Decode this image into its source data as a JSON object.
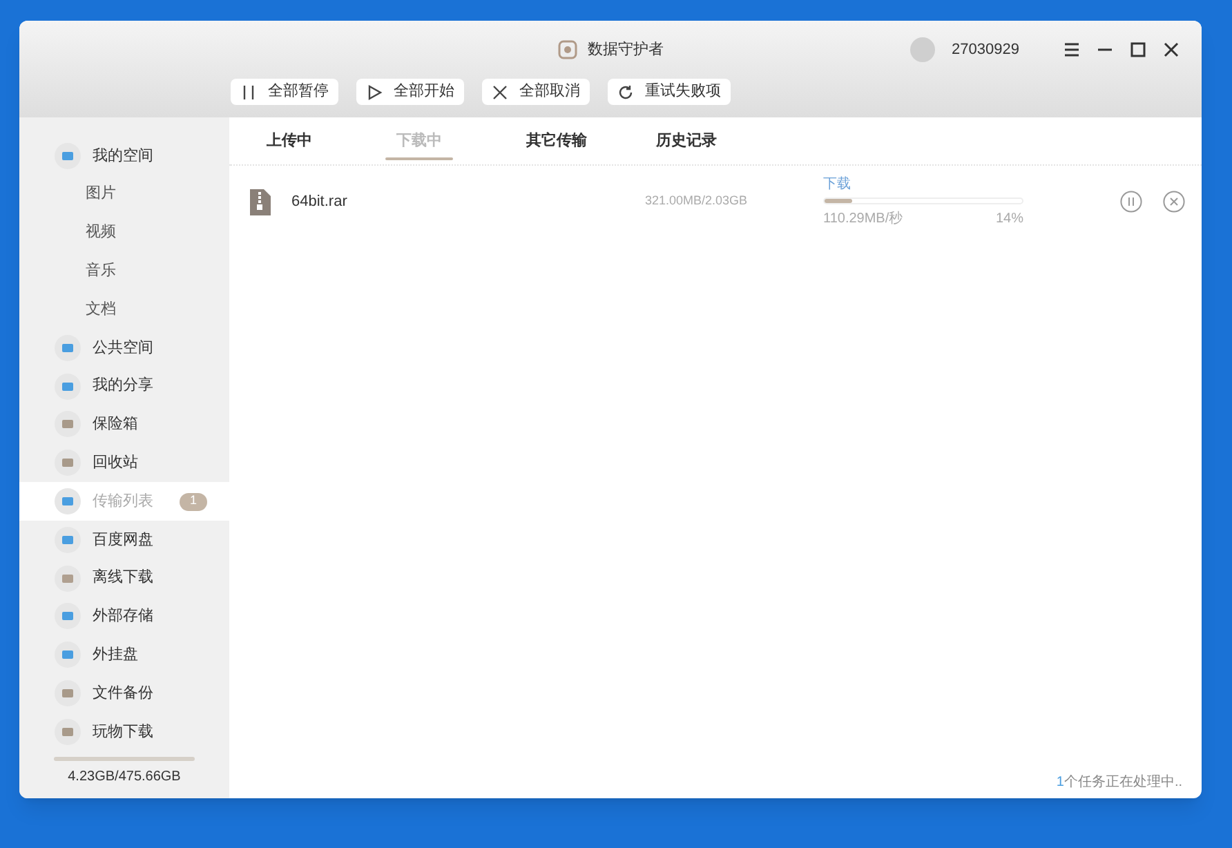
{
  "window": {
    "title": "数据守护者",
    "user_id": "27030929"
  },
  "toolbar": [
    {
      "label": "全部暂停",
      "kind": "pause"
    },
    {
      "label": "全部开始",
      "kind": "play"
    },
    {
      "label": "全部取消",
      "kind": "cancel"
    },
    {
      "label": "重试失败项",
      "kind": "retry"
    }
  ],
  "sidebar": {
    "items": [
      {
        "label": "我的空间",
        "selected": false,
        "kind": "main",
        "children": [
          {
            "label": "图片",
            "selected": false
          },
          {
            "label": "视频",
            "selected": false
          },
          {
            "label": "音乐",
            "selected": false
          },
          {
            "label": "文档",
            "selected": false
          }
        ]
      },
      {
        "label": "公共空间",
        "selected": false,
        "kind": "main"
      },
      {
        "label": "我的分享",
        "selected": false,
        "kind": "main"
      },
      {
        "label": "保险箱",
        "selected": false,
        "kind": "main"
      },
      {
        "label": "回收站",
        "selected": false,
        "kind": "main"
      },
      {
        "label": "传输列表",
        "selected": true,
        "kind": "main",
        "badge": "1"
      },
      {
        "label": "百度网盘",
        "selected": false,
        "kind": "main"
      },
      {
        "label": "离线下载",
        "selected": false,
        "kind": "main"
      },
      {
        "label": "外部存储",
        "selected": false,
        "kind": "main"
      },
      {
        "label": "外挂盘",
        "selected": false,
        "kind": "main"
      },
      {
        "label": "文件备份",
        "selected": false,
        "kind": "main"
      },
      {
        "label": "玩物下载",
        "selected": false,
        "kind": "main"
      }
    ],
    "storage": "4.23GB/475.66GB"
  },
  "tabs": [
    {
      "label": "上传中",
      "selected": false
    },
    {
      "label": "下载中",
      "selected": true
    },
    {
      "label": "其它传输",
      "selected": false
    },
    {
      "label": "历史记录",
      "selected": false
    }
  ],
  "transfers": [
    {
      "name": "64bit.rar",
      "size": "321.00MB/2.03GB",
      "status": "下载",
      "level": 0.14,
      "speed": "110.29MB/秒",
      "percent": "14%"
    }
  ],
  "status_bar": {
    "count": "1",
    "text": "个任务正在处理中.."
  }
}
